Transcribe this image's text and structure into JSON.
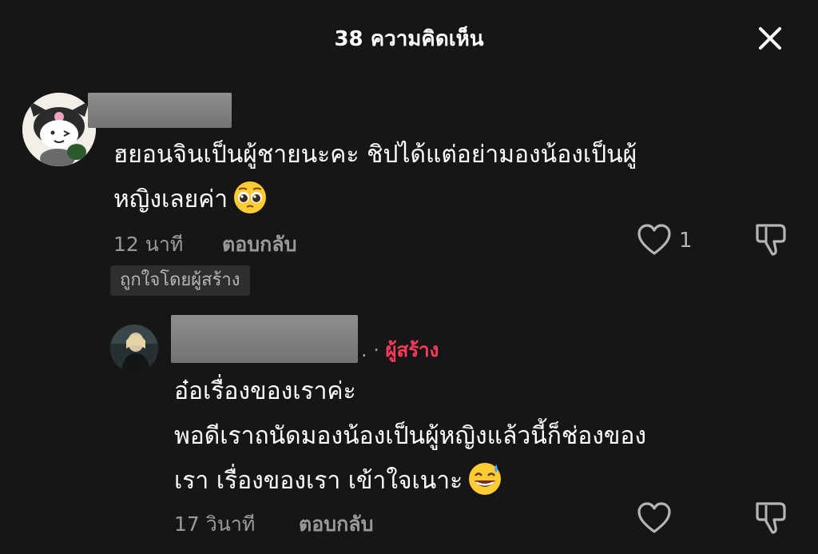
{
  "header": {
    "title": "38 ความคิดเห็น",
    "close_icon": "close-icon"
  },
  "comments": [
    {
      "username": "",
      "avatar": "kuromi-avatar",
      "text_lines": [
        "ฮยอนจินเป็นผู้ชายนะคะ ชิปได้แต่อย่ามองน้องเป็นผู้",
        "หญิงเลยค่า"
      ],
      "emoji": "pleading-face-emoji",
      "time": "12 นาที",
      "reply_label": "ตอบกลับ",
      "like_count": "1",
      "badge": "ถูกใจโดยผู้สร้าง"
    },
    {
      "username": "",
      "avatar": "creator-avatar",
      "creator_dot": ". ·",
      "creator_label": "ผู้สร้าง",
      "text_lines": [
        "อ๋อเรื่องของเราค่ะ",
        "พอดีเราถนัดมองน้องเป็นผู้หญิงแล้วนี้ก็ช่องของ",
        "เรา เรื่องของเรา เข้าใจเนาะ"
      ],
      "emoji": "grinning-sweat-emoji",
      "time": "17 วินาที",
      "reply_label": "ตอบกลับ"
    }
  ],
  "colors": {
    "background": "#161616",
    "creator_accent": "#ff3b5c",
    "muted_text": "#9a9a9a"
  }
}
